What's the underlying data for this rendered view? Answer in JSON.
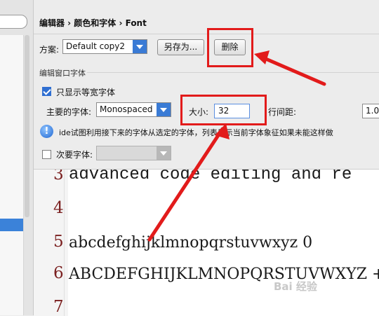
{
  "breadcrumb": "编辑器 › 颜色和字体 › Font",
  "scheme": {
    "label": "方案:",
    "value": "Default copy2",
    "save_as_label": "另存为...",
    "delete_label": "删除"
  },
  "editor_font_section": {
    "title": "编辑窗口字体",
    "monospace_only": {
      "label": "只显示等宽字体",
      "checked": true
    },
    "primary_font": {
      "label": "主要的字体:",
      "value": "Monospaced"
    },
    "size": {
      "label": "大小:",
      "value": "32"
    },
    "line_spacing": {
      "label": "行间距:",
      "value": "1.0"
    },
    "info_text": "ide试图利用接下来的字体从选定的字体，列表显示当前字体象征如果未能这样做",
    "secondary_font": {
      "label": "次要字体:",
      "checked": false,
      "value": ""
    }
  },
  "preview": {
    "lines": [
      {
        "num": "3",
        "text": "advanced code editing and re"
      },
      {
        "num": "4",
        "text": ""
      },
      {
        "num": "5",
        "text": "abcdefghijklmnopqrstuvwxyz 0"
      },
      {
        "num": "6",
        "text": "ABCDEFGHIJKLMNOPQRSTUVWXYZ +"
      },
      {
        "num": "7",
        "text": ""
      }
    ]
  },
  "watermark": "Bai 经验",
  "colors": {
    "annotation": "#e21b1b",
    "accent": "#3a7bd5"
  }
}
